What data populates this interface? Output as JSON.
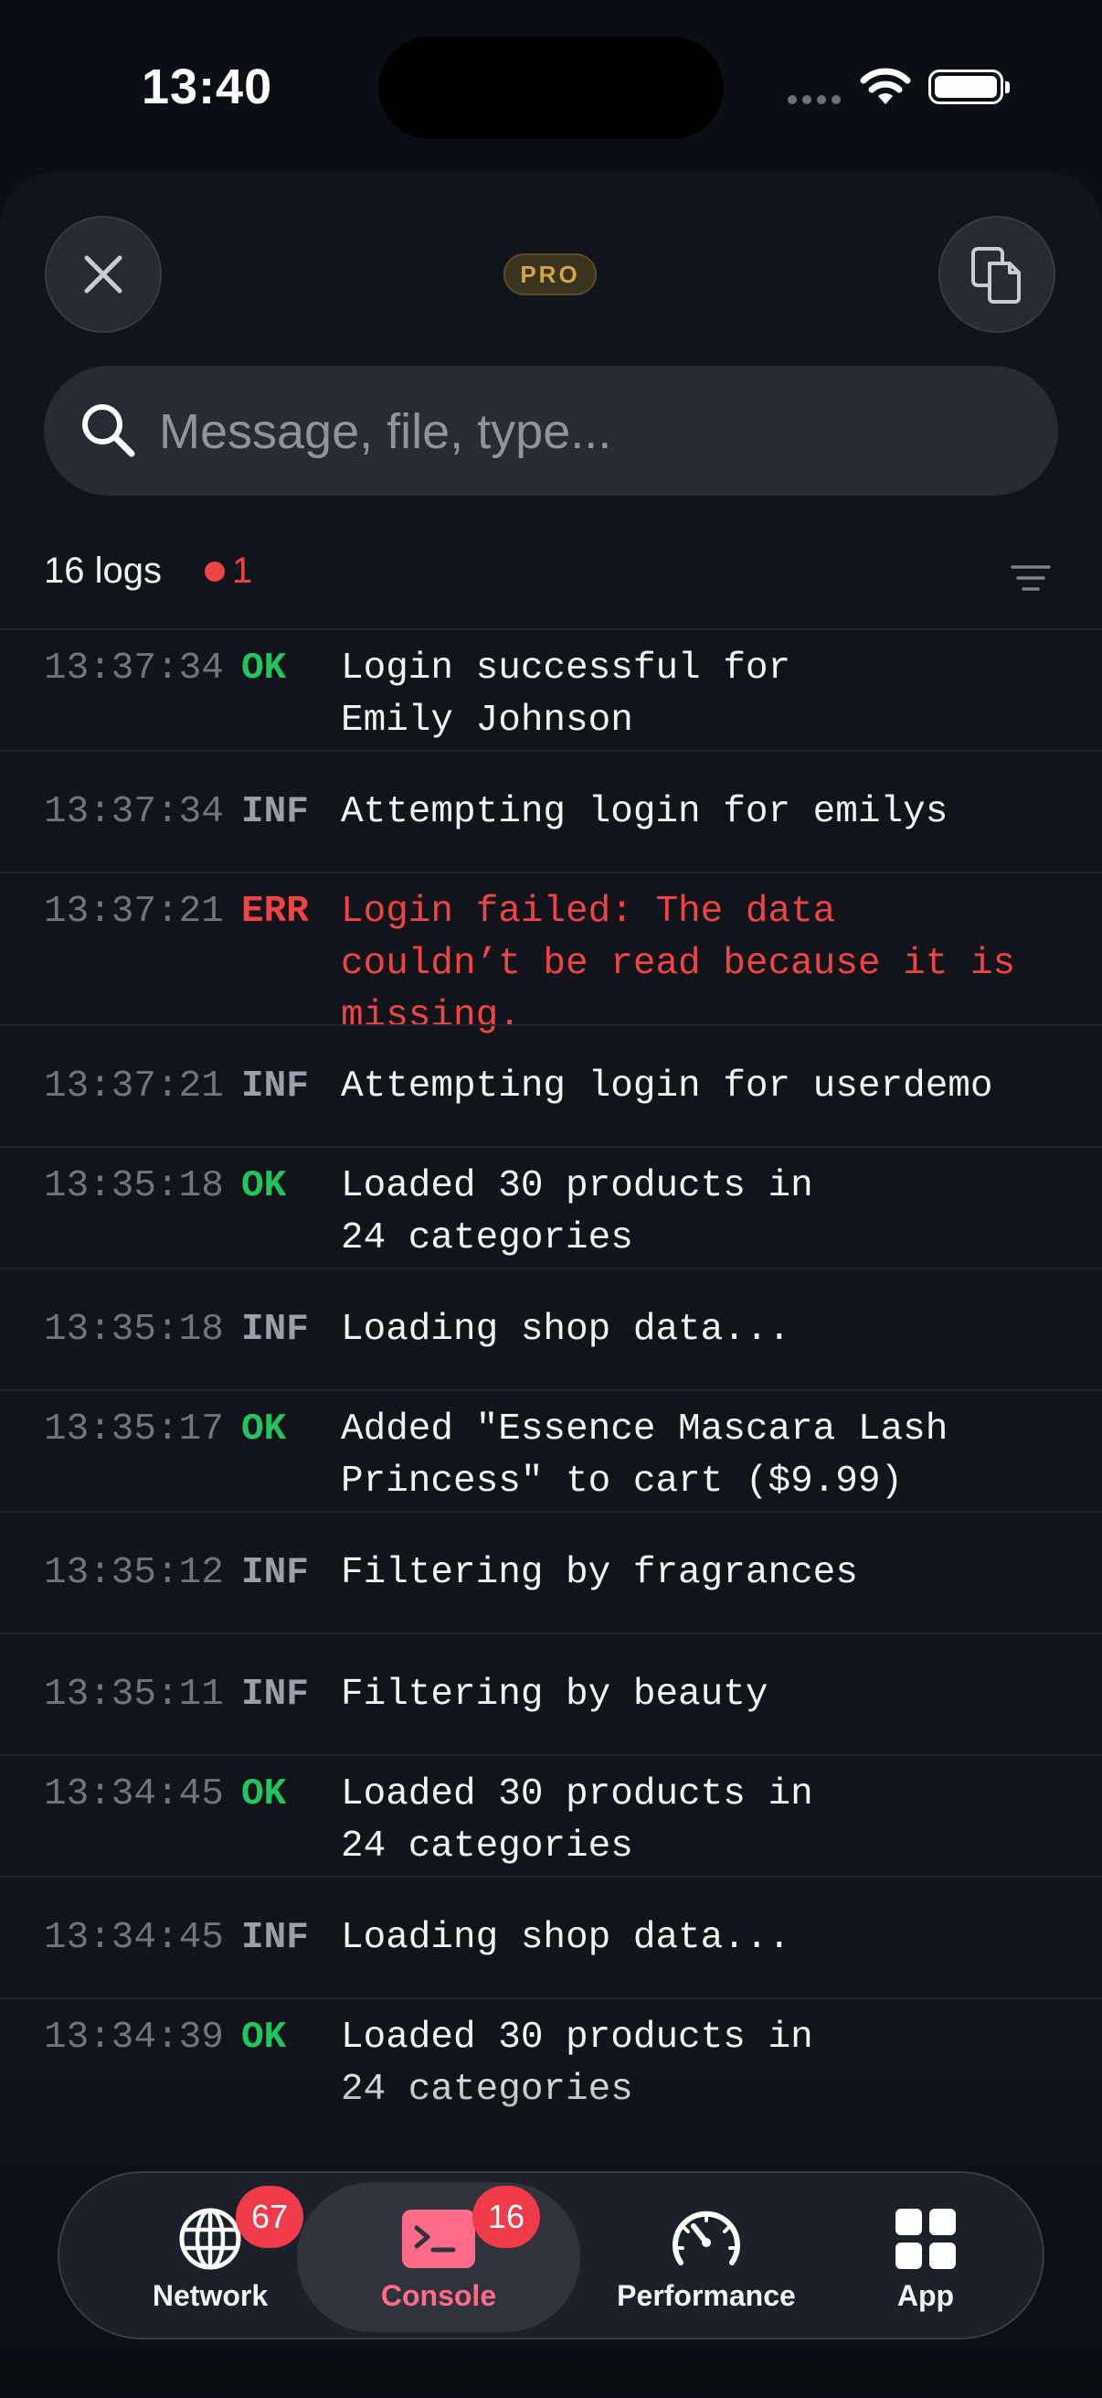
{
  "status_bar": {
    "time": "13:40"
  },
  "toolbar": {
    "pro_label": "PRO"
  },
  "search": {
    "placeholder": "Message, file, type..."
  },
  "summary": {
    "log_count": "16 logs",
    "error_count": "1"
  },
  "logs": [
    {
      "time": "13:37:34",
      "level": "OK",
      "message": "Login successful for\nEmily Johnson"
    },
    {
      "time": "13:37:34",
      "level": "INF",
      "message": "Attempting login for emilys"
    },
    {
      "time": "13:37:21",
      "level": "ERR",
      "message": "Login failed: The data\ncouldn’t be read because it is\nmissing."
    },
    {
      "time": "13:37:21",
      "level": "INF",
      "message": "Attempting login for userdemo"
    },
    {
      "time": "13:35:18",
      "level": "OK",
      "message": "Loaded 30 products in\n24 categories"
    },
    {
      "time": "13:35:18",
      "level": "INF",
      "message": "Loading shop data..."
    },
    {
      "time": "13:35:17",
      "level": "OK",
      "message": "Added \"Essence Mascara Lash\nPrincess\" to cart ($9.99)"
    },
    {
      "time": "13:35:12",
      "level": "INF",
      "message": "Filtering by fragrances"
    },
    {
      "time": "13:35:11",
      "level": "INF",
      "message": "Filtering by beauty"
    },
    {
      "time": "13:34:45",
      "level": "OK",
      "message": "Loaded 30 products in\n24 categories"
    },
    {
      "time": "13:34:45",
      "level": "INF",
      "message": "Loading shop data..."
    },
    {
      "time": "13:34:39",
      "level": "OK",
      "message": "Loaded 30 products in\n24 categories"
    }
  ],
  "tabs": [
    {
      "label": "Network",
      "badge": "67",
      "icon": "globe-icon"
    },
    {
      "label": "Console",
      "badge": "16",
      "icon": "terminal-icon"
    },
    {
      "label": "Performance",
      "badge": "",
      "icon": "gauge-icon"
    },
    {
      "label": "App",
      "badge": "",
      "icon": "grid-icon"
    }
  ],
  "colors": {
    "ok": "#22c55e",
    "info": "#9aa0ab",
    "error": "#ef4444",
    "accent": "#ff6b88",
    "pro": "#d1a543"
  }
}
